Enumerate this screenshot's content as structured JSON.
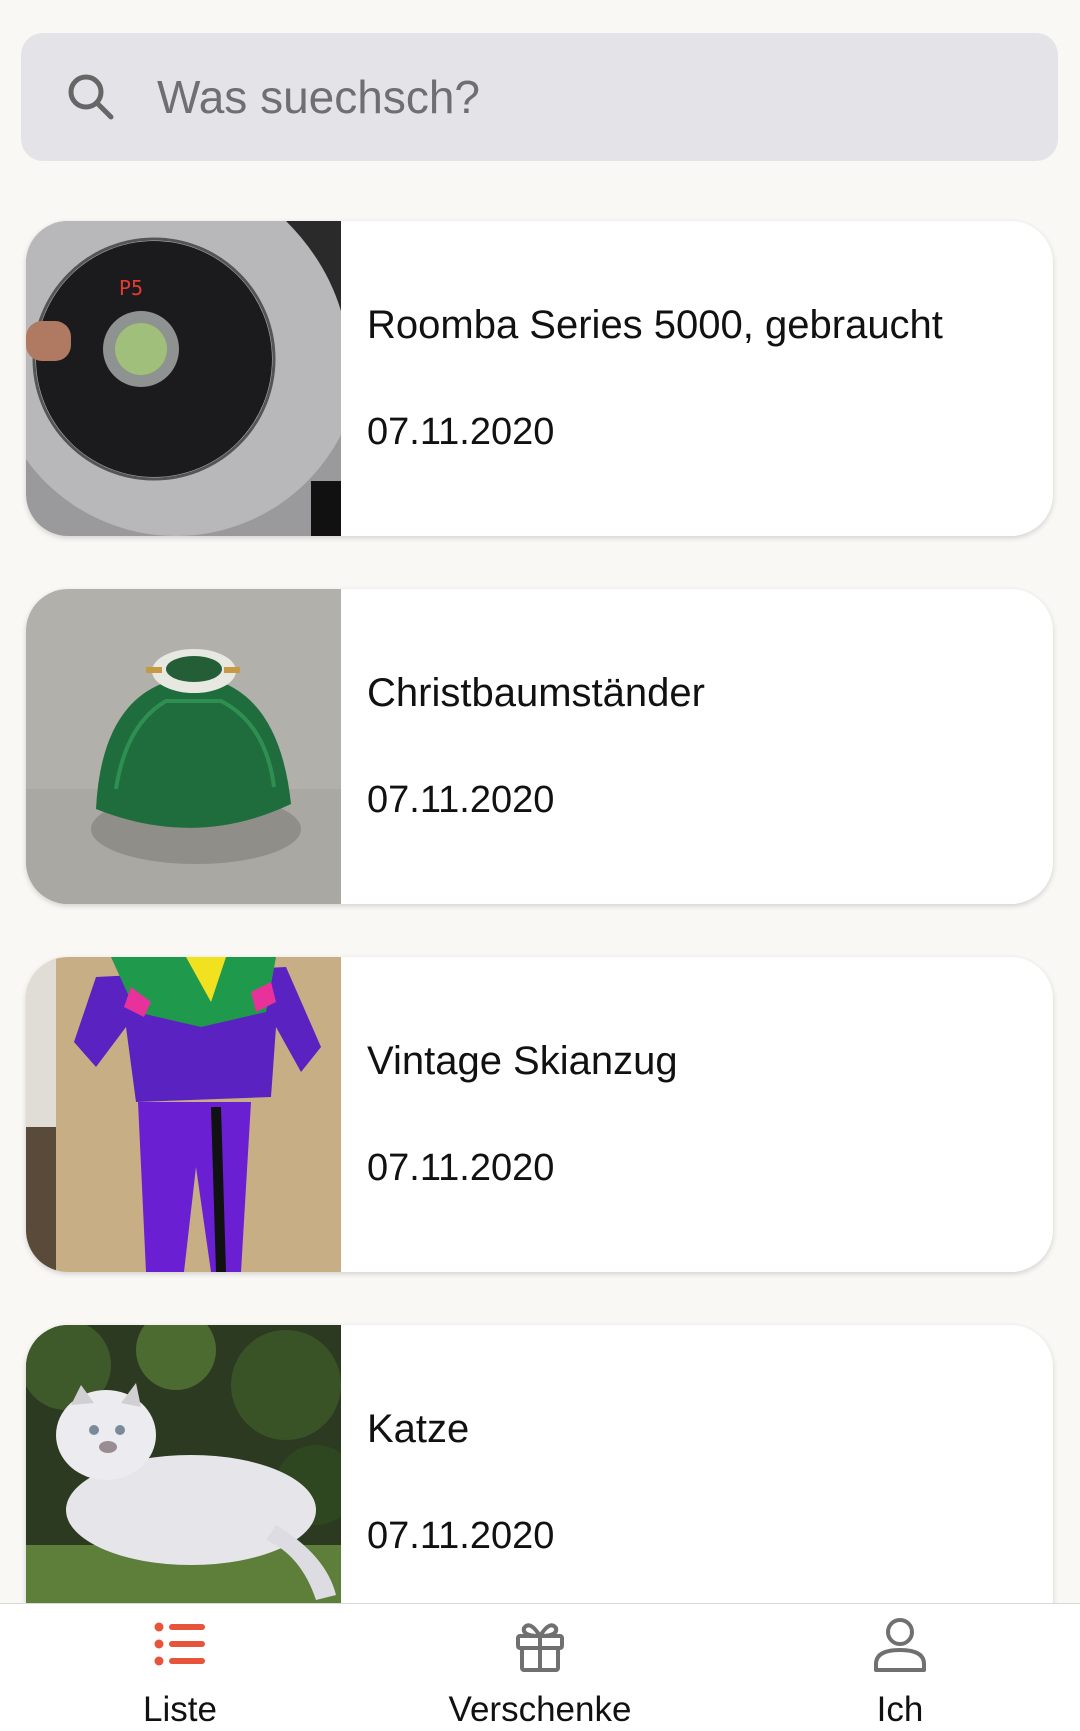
{
  "search": {
    "placeholder": "Was suechsch?",
    "value": ""
  },
  "items": [
    {
      "title": "Roomba Series 5000, gebraucht",
      "date": "07.11.2020",
      "image": "roomba-photo"
    },
    {
      "title": "Christbaumständer",
      "date": "07.11.2020",
      "image": "christmas-tree-stand-photo"
    },
    {
      "title": "Vintage Skianzug",
      "date": "07.11.2020",
      "image": "ski-suit-photo"
    },
    {
      "title": "Katze",
      "date": "07.11.2020",
      "image": "cat-photo"
    }
  ],
  "nav": [
    {
      "label": "Liste",
      "icon": "list-icon",
      "active": true
    },
    {
      "label": "Verschenke",
      "icon": "gift-icon",
      "active": false
    },
    {
      "label": "Ich",
      "icon": "person-icon",
      "active": false
    }
  ],
  "colors": {
    "accent": "#e8533b",
    "icon_inactive": "#707070",
    "search_bg": "#e4e3e8",
    "background": "#f9f8f5"
  }
}
